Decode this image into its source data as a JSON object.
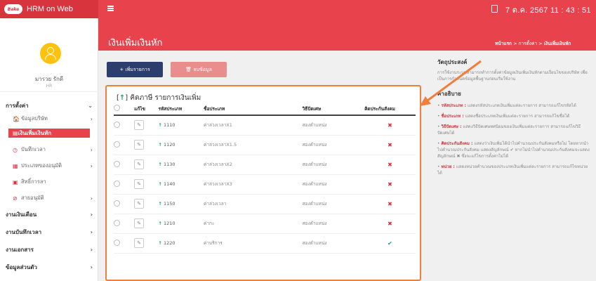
{
  "app": {
    "title": "HRM on Web",
    "logo_text": "Bake",
    "clock": "7 ต.ค. 2567  11 : 43 : 51"
  },
  "icons": {
    "menu": "hamburger-icon",
    "calendar": "calendar-icon",
    "avatar": "user-icon"
  },
  "colors": {
    "brand": "#e8424c",
    "navy": "#2c3e6b",
    "highlight": "#f07f3c",
    "green": "#19a36a"
  },
  "user": {
    "name": "มารวย รักดี",
    "role": "HR"
  },
  "sidebar": {
    "groups": [
      {
        "label": "การตั้งค่า",
        "chev": "⌄"
      },
      {
        "label": "งานเงินเดือน",
        "chev": "›"
      },
      {
        "label": "งานบันทึกเวลา",
        "chev": "›"
      },
      {
        "label": "งานเอกสาร",
        "chev": "›"
      },
      {
        "label": "ข้อมูลส่วนตัว",
        "chev": "›"
      }
    ],
    "items": [
      {
        "label": "ข้อมูลบริษัท",
        "icon": "🏠",
        "chev": "›"
      },
      {
        "label": "เงินเพิ่มเงินหัก",
        "icon": "▤",
        "chev": ""
      },
      {
        "label": "บันทึกเวลา",
        "icon": "◷",
        "chev": "›"
      },
      {
        "label": "ประเภทของอนุมัติ",
        "icon": "▦",
        "chev": "›"
      },
      {
        "label": "สิทธิ์การลา",
        "icon": "▣",
        "chev": ""
      },
      {
        "label": "สายอนุมัติ",
        "icon": "⊘",
        "chev": "›"
      }
    ]
  },
  "header": {
    "title": "เงินเพิ่มเงินหัก",
    "breadcrumb": {
      "home": "หน้าแรก",
      "sep": " > ",
      "mid": "การตั้งค่า",
      "current": "เงินเพิ่มเงินหัก"
    }
  },
  "toolbar": {
    "add_label": "+   เพิ่มรายการ",
    "delete_label": "🗑   ลบข้อมูล"
  },
  "table": {
    "title_icon": "↑",
    "title": "คิดภาษี รายการเงินเพิ่ม",
    "columns": [
      "",
      "แก้ไข",
      "รหัสประเภท",
      "ชื่อประเภท",
      "วิธีปัดเศษ",
      "คิดประกันสังคม"
    ],
    "rows": [
      {
        "code": "1110",
        "name": "ค่าล่วงเวลาX1",
        "rounding": "สองตำแหน่ง",
        "sso": "✖"
      },
      {
        "code": "1120",
        "name": "ค่าล่วงเวลาX1.5",
        "rounding": "สองตำแหน่ง",
        "sso": "✖"
      },
      {
        "code": "1130",
        "name": "ค่าล่วงเวลาX2",
        "rounding": "สองตำแหน่ง",
        "sso": "✖"
      },
      {
        "code": "1140",
        "name": "ค่าล่วงเวลาX3",
        "rounding": "สองตำแหน่ง",
        "sso": "✖"
      },
      {
        "code": "1150",
        "name": "ค่าล่วงเวลา",
        "rounding": "สองตำแหน่ง",
        "sso": "✖"
      },
      {
        "code": "1210",
        "name": "ค่ากะ",
        "rounding": "สองตำแหน่ง",
        "sso": "✖"
      },
      {
        "code": "1220",
        "name": "ค่าบริการ",
        "rounding": "สองตำแหน่ง",
        "sso": "✔"
      }
    ]
  },
  "help": {
    "purpose_title": "วัตถุประสงค์",
    "purpose_text": "การใช้งานระบบสามารถทำการตั้งค่าข้อมูลเงินเพิ่มเงินหักตามเงื่อนไขของบริษัท เพื่อเป็นการกำหนดข้อมูลพื้นฐานก่อนเริ่มใช้งาน",
    "desc_title": "คำอธิบาย",
    "items": [
      {
        "term": "รหัสประเภท :",
        "text": " แสดงรหัสประเภทเงินเพิ่มแต่ละรายการ สามารถแก้ไขรหัสได้"
      },
      {
        "term": "ชื่อประเภท :",
        "text": " แสดงชื่อประเภทเงินเพิ่มแต่ละรายการ สามารถแก้ไขชื่อได้"
      },
      {
        "term": "วิธีปัดเศษ :",
        "text": " แสดงวิธีปัดเศษทศนิยมของเงินเพิ่มแต่ละรายการ สามารถแก้ไขวิธีปัดเศษได้"
      },
      {
        "term": "คิดประกันสังคม :",
        "text": " แสดงว่าเงินเพิ่มได้นำไปคำนวณประกันสังคมหรือไม่ โดยหากนำไปคำนวณประกันสังคม แสดงสัญลักษณ์ ✔ หากไม่นำไปคำนวณประกันสังคมจะแสดงสัญลักษณ์ ✖ ซึ่งจะแก้ไขการตั้งค่าไม่ได้"
      },
      {
        "term": "หน่วย :",
        "text": " แสดงหน่วยคำนวณของประเภทเงินเพิ่มแต่ละรายการ สามารถแก้ไขหน่วยได้"
      }
    ]
  }
}
